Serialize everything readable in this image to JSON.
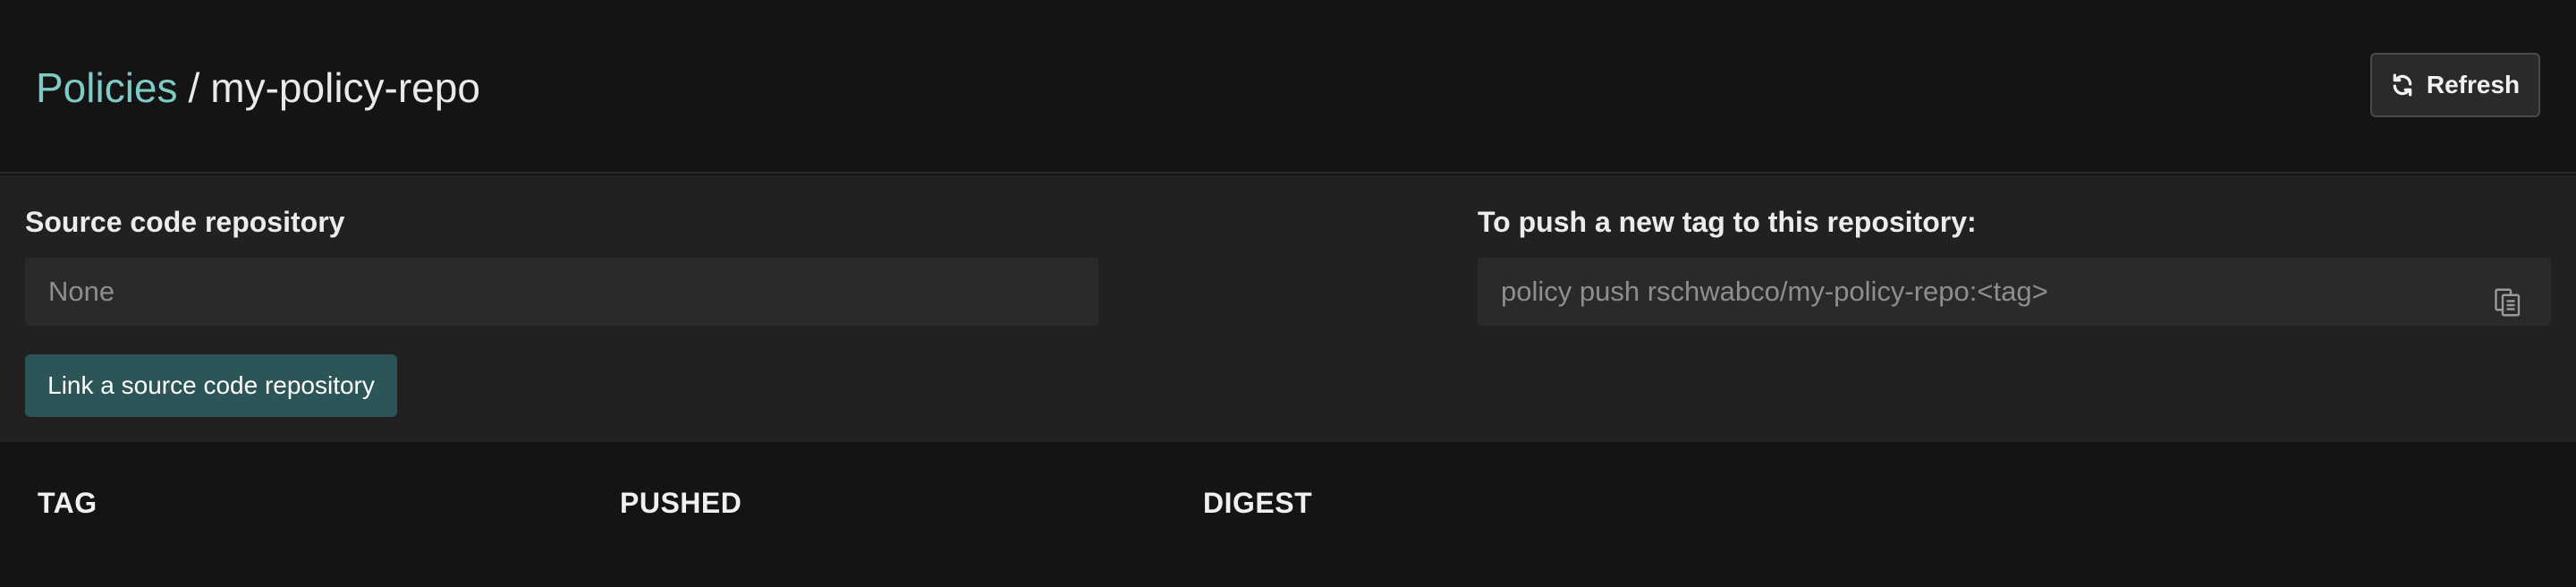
{
  "header": {
    "breadcrumb_root": "Policies",
    "breadcrumb_separator": "/",
    "breadcrumb_current": "my-policy-repo",
    "refresh_label": "Refresh",
    "refresh_icon": "refresh-icon"
  },
  "source_repo": {
    "label": "Source code repository",
    "value": "None",
    "link_button_label": "Link a source code repository"
  },
  "push": {
    "label": "To push a new tag to this repository:",
    "command": "policy push rschwabco/my-policy-repo:<tag>",
    "copy_icon": "copy-icon"
  },
  "table": {
    "columns": [
      "TAG",
      "PUSHED",
      "DIGEST"
    ]
  },
  "colors": {
    "accent": "#7ecac6",
    "button_primary": "#2b5556",
    "background": "#141414",
    "panel": "#212121"
  }
}
